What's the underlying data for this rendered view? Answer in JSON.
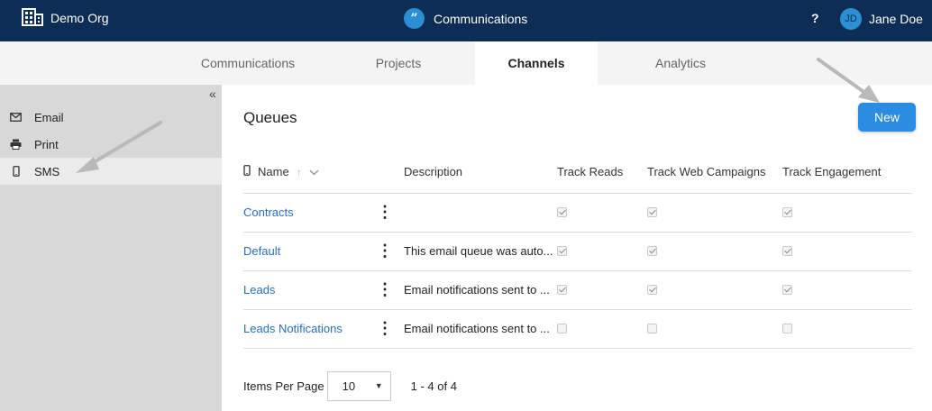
{
  "header": {
    "org_label": "Demo Org",
    "app_label": "Communications",
    "help_label": "?",
    "user_initials": "JD",
    "user_name": "Jane Doe",
    "colors": {
      "bar": "#0e2d54",
      "accent": "#2c8fd4"
    }
  },
  "tabs": [
    {
      "label": "Communications",
      "active": false
    },
    {
      "label": "Projects",
      "active": false
    },
    {
      "label": "Channels",
      "active": true
    },
    {
      "label": "Analytics",
      "active": false
    }
  ],
  "sidebar": {
    "collapse_glyph": "«",
    "items": [
      {
        "label": "Email",
        "icon": "envelope-icon",
        "selected": false
      },
      {
        "label": "Print",
        "icon": "printer-icon",
        "selected": false
      },
      {
        "label": "SMS",
        "icon": "mobile-icon",
        "selected": true
      }
    ]
  },
  "main": {
    "title": "Queues",
    "new_button": "New",
    "columns": {
      "name": "Name",
      "description": "Description",
      "track_reads": "Track Reads",
      "track_web": "Track Web Campaigns",
      "track_engagement": "Track Engagement"
    },
    "rows": [
      {
        "name": "Contracts",
        "description": "",
        "track_reads": true,
        "track_web": true,
        "track_engagement": true
      },
      {
        "name": "Default",
        "description": "This email queue was auto...",
        "track_reads": true,
        "track_web": true,
        "track_engagement": true
      },
      {
        "name": "Leads",
        "description": "Email notifications sent to ...",
        "track_reads": true,
        "track_web": true,
        "track_engagement": true
      },
      {
        "name": "Leads Notifications",
        "description": "Email notifications sent to ...",
        "track_reads": false,
        "track_web": false,
        "track_engagement": false
      }
    ],
    "pager": {
      "label": "Items Per Page",
      "page_size": "10",
      "range": "1 - 4 of 4"
    }
  }
}
